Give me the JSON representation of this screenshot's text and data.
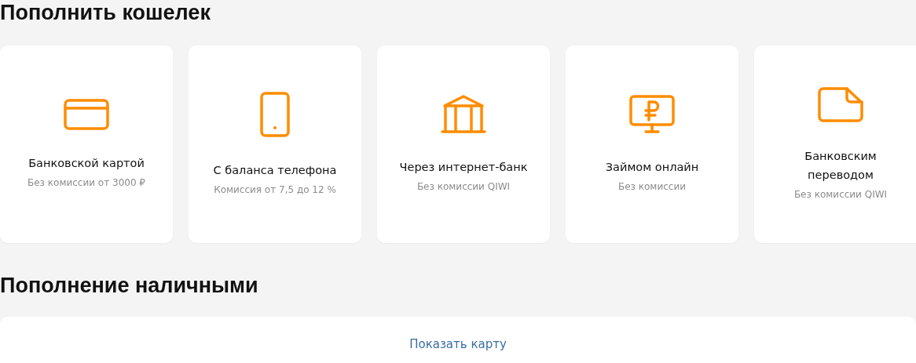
{
  "sections": [
    {
      "title": "Пополнить кошелек",
      "methods": [
        {
          "kind": "card",
          "title": "Банковской картой",
          "note": "Без комиссии от 3000 ₽"
        },
        {
          "kind": "phone",
          "title": "С баланса телефона",
          "note": "Комиссия от 7,5 до 12 %"
        },
        {
          "kind": "bank",
          "title": "Через интернет-банк",
          "note": "Без комиссии QIWI"
        },
        {
          "kind": "loan",
          "title": "Займом онлайн",
          "note": "Без комиссии"
        },
        {
          "kind": "transfer",
          "title": "Банковским\nпереводом",
          "note": "Без комиссии QIWI"
        }
      ]
    },
    {
      "title": "Пополнение наличными",
      "link": "Показать карту"
    }
  ]
}
